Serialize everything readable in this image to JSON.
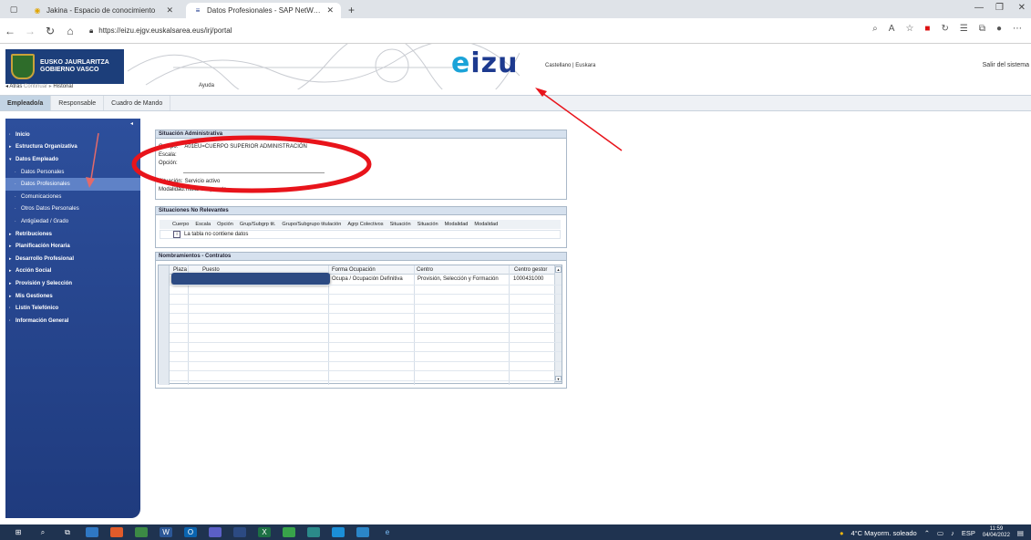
{
  "browser": {
    "tabs": [
      {
        "title": "Jakina - Espacio de conocimiento",
        "active": false
      },
      {
        "title": "Datos Profesionales - SAP NetWeaver",
        "active": true
      }
    ],
    "url": "https://eizu.ejgv.euskalsarea.eus/irj/portal",
    "colors": {
      "chrome": "#dfe3e8",
      "accent_red": "#d11111"
    }
  },
  "header": {
    "logo_line1": "EUSKO JAURLARITZA",
    "logo_line2": "GOBIERNO VASCO",
    "brand": "eizu",
    "lang_es": "Castellano",
    "lang_sep": "|",
    "lang_eu": "Euskara",
    "logout": "Salir del sistema",
    "history": {
      "back": "◂ Atrás",
      "forward": "Continuar ▸",
      "history": "Historial"
    },
    "help": "Ayuda",
    "colors": {
      "brand_blue": "#1d3a8f",
      "brand_cyan": "#1ba3d8",
      "logo_bg": "#1c3e7a"
    }
  },
  "portal_tabs": [
    "Empleado/a",
    "Responsable",
    "Cuadro de Mando"
  ],
  "sidebar": {
    "items": [
      {
        "label": "Inicio",
        "level": 0,
        "marker": "·"
      },
      {
        "label": "Estructura Organizativa",
        "level": 0,
        "marker": "▸"
      },
      {
        "label": "Datos Empleado",
        "level": 0,
        "marker": "▾"
      },
      {
        "label": "Datos Personales",
        "level": 1,
        "marker": "·"
      },
      {
        "label": "Datos Profesionales",
        "level": 1,
        "marker": "·",
        "selected": true
      },
      {
        "label": "Comunicaciones",
        "level": 1,
        "marker": "·"
      },
      {
        "label": "Otros Datos Personales",
        "level": 1,
        "marker": "·"
      },
      {
        "label": "Antigüedad / Grado",
        "level": 1,
        "marker": "·"
      },
      {
        "label": "Retribuciones",
        "level": 0,
        "marker": "▸"
      },
      {
        "label": "Planificación Horaria",
        "level": 0,
        "marker": "▸"
      },
      {
        "label": "Desarrollo Profesional",
        "level": 0,
        "marker": "▸"
      },
      {
        "label": "Acción Social",
        "level": 0,
        "marker": "▸"
      },
      {
        "label": "Provisión y Selección",
        "level": 0,
        "marker": "▸"
      },
      {
        "label": "Mis Gestiones",
        "level": 0,
        "marker": "▸"
      },
      {
        "label": "Listín Telefónico",
        "level": 0,
        "marker": "·"
      },
      {
        "label": "Información General",
        "level": 0,
        "marker": "·"
      }
    ],
    "colors": {
      "bg": "#2d4f9c",
      "selected": "#5f82c7"
    }
  },
  "situacion": {
    "title": "Situación Administrativa",
    "cuerpo_label": "Cuerpo:",
    "cuerpo_value": "A01EU=CUERPO SUPERIOR ADMINISTRACIÓN",
    "escala_label": "Escala:",
    "opcion_label": "Opción:",
    "situacion_label": "Situación:",
    "situacion_value": "Servicio activo",
    "modalidad_label": "Modalidad:",
    "modalidad_value": "Titular del puesto"
  },
  "no_relevantes": {
    "title": "Situaciones No Relevantes",
    "columns": [
      "Cuerpo",
      "Escala",
      "Opción",
      "Grup/Subgrp tit.",
      "Grupo/Subgrupo titulación",
      "Agrp Colectivos",
      "Situación",
      "Situación",
      "Modalidad",
      "Modalidad"
    ],
    "empty_message": "La tabla no contiene datos"
  },
  "nombramientos": {
    "title": "Nombramientos - Contratos",
    "columns": [
      "Plaza",
      "Puesto",
      "Forma Ocupación",
      "Centro",
      "Centro gestor"
    ],
    "rows": [
      {
        "forma": "Ocupa / Ocupación Definitiva",
        "centro": "Provisión, Selección y Formación",
        "gestor": "1000431000"
      }
    ]
  },
  "taskbar": {
    "weather": "4°C  Mayorm. soleado",
    "lang": "ESP",
    "time": "11:59",
    "date": "04/04/2022"
  }
}
